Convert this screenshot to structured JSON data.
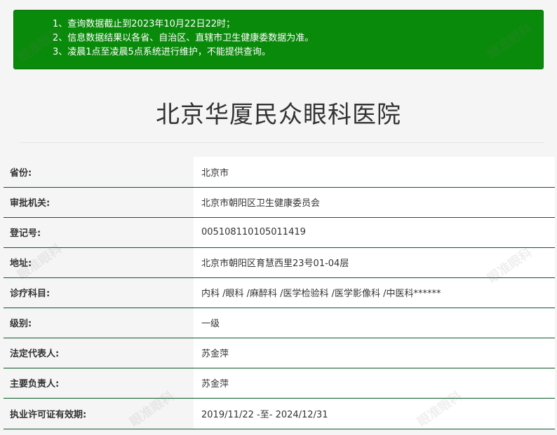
{
  "notice": {
    "lines": [
      "1、查询数据截止到2023年10月22日22时；",
      "2、信息数据结果以各省、自治区、直辖市卫生健康委数据为准。",
      "3、凌晨1点至凌晨5点系统进行维护，不能提供查询。"
    ]
  },
  "hospital": {
    "name": "北京华厦民众眼科医院"
  },
  "info": [
    {
      "label": "省份:",
      "value": "北京市"
    },
    {
      "label": "审批机关:",
      "value": "北京市朝阳区卫生健康委员会"
    },
    {
      "label": "登记号:",
      "value": "005108110105011419"
    },
    {
      "label": "地址:",
      "value": "北京市朝阳区育慧西里23号01-04层"
    },
    {
      "label": "诊疗科目:",
      "value": "内科 /眼科 /麻醉科 /医学检验科 /医学影像科 /中医科******"
    },
    {
      "label": "级别:",
      "value": "一级"
    },
    {
      "label": "法定代表人:",
      "value": "苏金萍"
    },
    {
      "label": "主要负责人:",
      "value": "苏金萍"
    },
    {
      "label": "执业许可证有效期:",
      "value": "2019/11/22 -至- 2024/12/31"
    }
  ],
  "watermark": {
    "text": "眼准眼科"
  },
  "colors": {
    "notice_bg": "#0a8a0a",
    "row_border": "#0a5a2a"
  }
}
